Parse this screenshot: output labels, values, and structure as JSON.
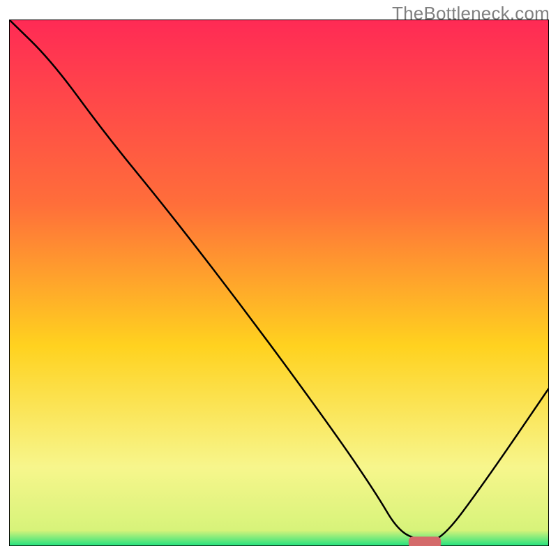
{
  "watermark": "TheBottleneck.com",
  "chart_data": {
    "type": "line",
    "title": "",
    "xlabel": "",
    "ylabel": "",
    "xlim": [
      0,
      100
    ],
    "ylim": [
      0,
      100
    ],
    "grid": false,
    "legend": false,
    "gradient_colors": {
      "top": "#ff2a55",
      "upper": "#ff6e3a",
      "mid": "#ffd21f",
      "lower": "#f7f68c",
      "bottom": "#1ee27e"
    },
    "series": [
      {
        "name": "bottleneck-curve",
        "color": "#000000",
        "x": [
          0,
          8,
          18,
          30,
          45,
          60,
          68,
          72,
          76,
          80,
          88,
          100
        ],
        "y": [
          100,
          92,
          78,
          63,
          43,
          22,
          10,
          3,
          1,
          1,
          12,
          30
        ]
      }
    ],
    "marker": {
      "name": "optimal-marker",
      "color": "#d46a6a",
      "x_start": 74,
      "x_end": 80,
      "y": 0.7,
      "thickness": 2.2
    }
  }
}
